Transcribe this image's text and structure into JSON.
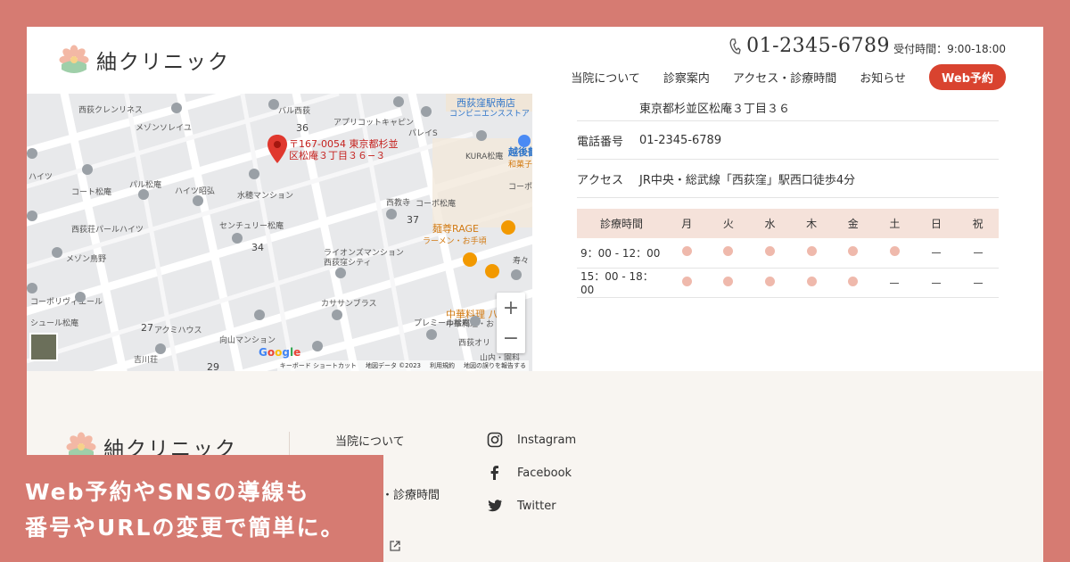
{
  "header": {
    "logo_text": "紬クリニック",
    "phone": "01-2345-6789",
    "hours": "受付時間：9:00-18:00",
    "nav": [
      "当院について",
      "診察案内",
      "アクセス・診療時間",
      "お知らせ"
    ],
    "web_button": "Web予約"
  },
  "map": {
    "pin_label_1": "〒167-0054 東京都杉並",
    "pin_label_2": "区松庵３丁目３６−３",
    "labels": [
      "西荻クレンリネス",
      "メゾンソレイユ",
      "バル西荻",
      "アプリコットキャピン",
      "パレイS",
      "KURA松庵",
      "越後鶴",
      "和菓子",
      "京料",
      "コーポ松庵",
      "西教寺",
      "ハイツ",
      "コート松庵",
      "パル松庵",
      "ハイツ昭弘",
      "水穂マンション",
      "西荻荘パールハイツ",
      "センチュリー松庵",
      "メゾン鳥野",
      "ライオンズマンション",
      "西荻窪シティ",
      "コーポリヴィエール",
      "シュール松庵",
      "アクミハウス",
      "カササンブラス",
      "プレミール松庵",
      "向山マンション",
      "西荻オリ",
      "山内・園科",
      "吉川荘",
      "寿々",
      "中華料理・お"
    ],
    "shop_labels": [
      "麺尊RAGE",
      "ラーメン・お手頃",
      "中華料理 八龍"
    ],
    "station_labels": [
      "西荻窪駅南店",
      "コンビニエンスストア"
    ],
    "numbers": [
      "36",
      "37",
      "34",
      "27",
      "29"
    ],
    "google": "Google",
    "footer_items": [
      "キーボード ショートカット",
      "地図データ ©2023",
      "利用規約",
      "地図の誤りを報告する"
    ],
    "zoom_in": "+",
    "zoom_out": "−"
  },
  "info": {
    "address": "東京都杉並区松庵３丁目３６",
    "phone_label": "電話番号",
    "phone_value": "01-2345-6789",
    "access_label": "アクセス",
    "access_value": "JR中央・総武線「西荻窪」駅西口徒歩4分"
  },
  "schedule": {
    "header": [
      "診療時間",
      "月",
      "火",
      "水",
      "木",
      "金",
      "土",
      "日",
      "祝"
    ],
    "rows": [
      {
        "time": "9：00 - 12：00",
        "open": [
          true,
          true,
          true,
          true,
          true,
          true,
          false,
          false
        ]
      },
      {
        "time": "15：00 - 18：00",
        "open": [
          true,
          true,
          true,
          true,
          true,
          false,
          false,
          false
        ]
      }
    ]
  },
  "footer": {
    "logo_text": "紬クリニック",
    "links": [
      "当院について",
      "・診療時間"
    ],
    "sns": [
      "Instagram",
      "Facebook",
      "Twitter"
    ]
  },
  "caption": {
    "line1": "Web予約やSNSの導線も",
    "line2": "番号やURLの変更で簡単に。"
  },
  "colors": {
    "frame": "#D67B72",
    "accent": "#D9432F",
    "schedule_header": "#F5E2DA",
    "dot": "#EFB9AC",
    "footer_bg": "#F8F5F1"
  }
}
